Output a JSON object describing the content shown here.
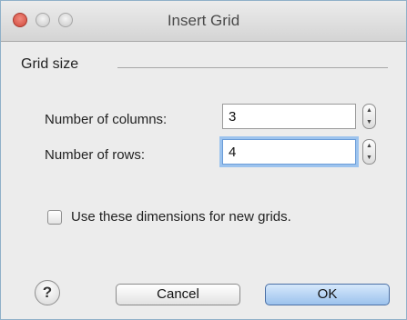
{
  "window": {
    "title": "Insert Grid"
  },
  "grid_size": {
    "group_label": "Grid size",
    "columns": {
      "label": "Number of columns:",
      "value": "3"
    },
    "rows": {
      "label": "Number of rows:",
      "value": "4"
    }
  },
  "options": {
    "use_dimensions_label": "Use these dimensions for new grids.",
    "use_dimensions_checked": false
  },
  "buttons": {
    "help_glyph": "?",
    "cancel_label": "Cancel",
    "ok_label": "OK"
  },
  "icons": {
    "close": "close-icon",
    "minimize": "minimize-icon",
    "maximize": "maximize-icon",
    "help": "help-icon"
  },
  "colors": {
    "close_button": "#d0473a",
    "ok_button": "#9cc2ed",
    "focus_ring": "#9cc3ee"
  }
}
